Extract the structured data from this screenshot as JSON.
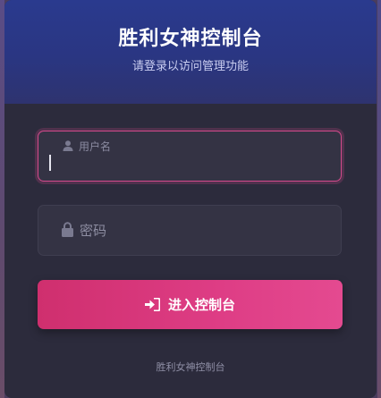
{
  "header": {
    "title": "胜利女神控制台",
    "subtitle": "请登录以访问管理功能"
  },
  "form": {
    "username": {
      "label": "用户名",
      "value": "",
      "icon": "user-icon"
    },
    "password": {
      "placeholder": "密码",
      "value": "",
      "icon": "lock-icon"
    },
    "submit": {
      "label": "进入控制台",
      "icon": "sign-in-icon"
    }
  },
  "footer": {
    "text": "胜利女神控制台"
  },
  "colors": {
    "accent": "#de3d85",
    "header_bg": "#2a3682",
    "card_bg": "#2c2b3c",
    "field_bg": "#343344"
  }
}
